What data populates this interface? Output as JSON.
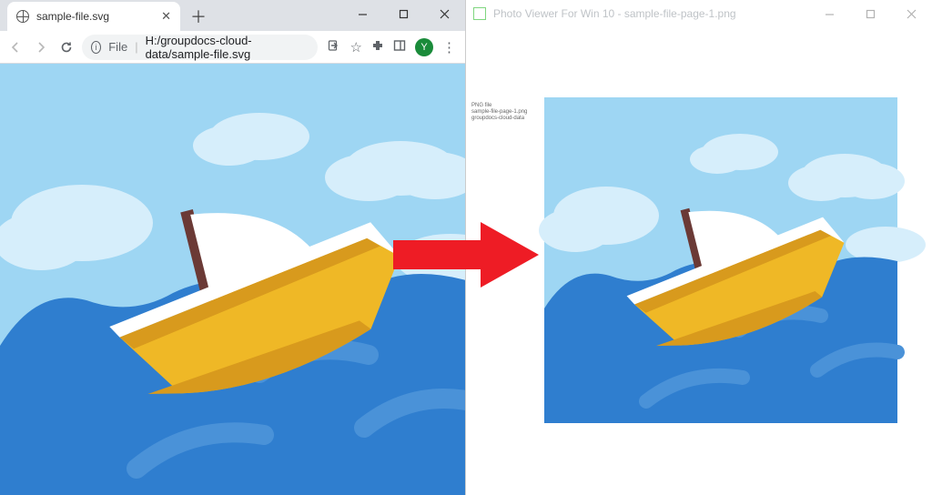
{
  "left": {
    "tab_title": "sample-file.svg",
    "address": {
      "protocol_label": "File",
      "path": "H:/groupdocs-cloud-data/sample-file.svg"
    },
    "profile_letter": "Y"
  },
  "right": {
    "app_title": "Photo Viewer For Win 10 - sample-file-page-1.png",
    "caption_small": "PNG file\nsample-file-page-1.png\ngroupdocs-cloud-data"
  },
  "colors": {
    "sky": "#9ed6f3",
    "cloud": "#d6eefb",
    "wave_dark": "#2f7ecf",
    "wave_light": "#4a92d8",
    "hull_yellow": "#efb826",
    "hull_orange": "#d89a1d",
    "deck_white": "#ffffff",
    "mast": "#6b3a36",
    "arrow_red": "#ee1c25",
    "chrome_bar": "#dee1e6"
  }
}
